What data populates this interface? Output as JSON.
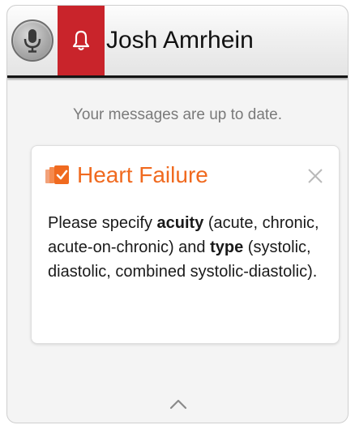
{
  "header": {
    "user_name": "Josh Amrhein",
    "mic_icon": "microphone-icon",
    "alert_icon": "bell-icon",
    "alert_color": "#c9242b"
  },
  "status": {
    "text": "Your messages are up to date."
  },
  "card": {
    "icon": "document-icon",
    "title": "Heart Failure",
    "title_color": "#f06a1f",
    "close_icon": "close-icon",
    "body": {
      "t1": "Please specify ",
      "b1": "acuity",
      "t2": " (acute, chronic, acute-on-chronic) and ",
      "b2": "type",
      "t3": " (systolic, diastolic, combined systolic-diastolic)."
    }
  },
  "footer": {
    "collapse_icon": "chevron-up-icon"
  }
}
